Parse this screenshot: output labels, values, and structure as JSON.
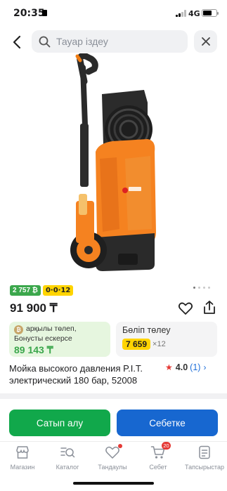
{
  "status_bar": {
    "time": "20:35",
    "network": "4G"
  },
  "search": {
    "placeholder": "Тауар іздеу"
  },
  "gallery": {
    "page_count": 4,
    "active_index": 0
  },
  "badges": {
    "bonus": "2 757 ₿",
    "installment": "0·0·12"
  },
  "product": {
    "price": "91 900 ₸",
    "title": "Мойка высокого давления P.I.T. электрический 180 бар, 52008",
    "rating": "4.0",
    "reviews": "(1)"
  },
  "bonus_card": {
    "coin": "₿",
    "line1": "арқылы төлеп,",
    "line2": "Бонусты ескерсе",
    "amount": "89 143 ₸"
  },
  "installment_card": {
    "title": "Бөліп төлеу",
    "amount": "7 659",
    "months": "×12"
  },
  "actions": {
    "buy_label": "Сатып алу",
    "cart_label": "Себетке"
  },
  "tabbar": {
    "items": [
      {
        "label": "Магазин",
        "icon": "store-icon"
      },
      {
        "label": "Каталог",
        "icon": "catalog-search-icon"
      },
      {
        "label": "Тандаулы",
        "icon": "heart-icon"
      },
      {
        "label": "Себет",
        "icon": "cart-icon",
        "badge": "20"
      },
      {
        "label": "Тапсырыстар",
        "icon": "orders-icon"
      }
    ]
  },
  "colors": {
    "accent_green": "#11a84b",
    "accent_blue": "#1767d0",
    "installment_yellow": "#ffd400",
    "alert_red": "#e53935"
  }
}
